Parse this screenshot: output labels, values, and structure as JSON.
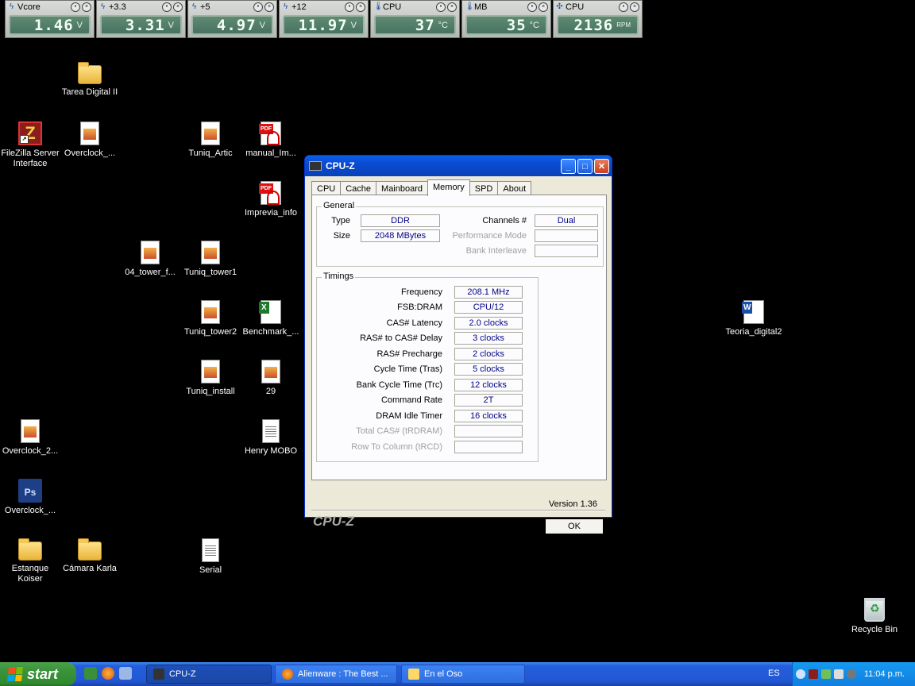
{
  "gadgets": [
    {
      "name": "Vcore",
      "value": "1.46",
      "unit": "V",
      "icon": "lightning-icon"
    },
    {
      "name": "+3.3",
      "value": "3.31",
      "unit": "V",
      "icon": "lightning-icon"
    },
    {
      "name": "+5",
      "value": "4.97",
      "unit": "V",
      "icon": "lightning-icon"
    },
    {
      "name": "+12",
      "value": "11.97",
      "unit": "V",
      "icon": "lightning-icon"
    },
    {
      "name": "CPU",
      "value": "37",
      "unit": "°C",
      "icon": "thermometer-icon"
    },
    {
      "name": "MB",
      "value": "35",
      "unit": "°C",
      "icon": "thermometer-icon"
    },
    {
      "name": "CPU",
      "value": "2136",
      "unit": "RPM",
      "icon": "fan-icon"
    }
  ],
  "desktop_icons": [
    {
      "label": "Tarea Digital II",
      "type": "folder"
    },
    {
      "label": "FileZilla Server Interface",
      "type": "filezilla"
    },
    {
      "label": "Overclock_...",
      "type": "image"
    },
    {
      "label": "Tuniq_Artic",
      "type": "image"
    },
    {
      "label": "manual_Im...",
      "type": "pdf"
    },
    {
      "label": "Imprevia_info",
      "type": "pdf"
    },
    {
      "label": "04_tower_f...",
      "type": "image"
    },
    {
      "label": "Tuniq_tower1",
      "type": "image"
    },
    {
      "label": "Tuniq_tower2",
      "type": "image"
    },
    {
      "label": "Benchmark_...",
      "type": "excel"
    },
    {
      "label": "Teoria_digital2",
      "type": "word"
    },
    {
      "label": "Tuniq_install",
      "type": "image"
    },
    {
      "label": "29",
      "type": "image"
    },
    {
      "label": "Overclock_2...",
      "type": "image"
    },
    {
      "label": "Henry MOBO",
      "type": "text"
    },
    {
      "label": "Overclock_...",
      "type": "photoshop"
    },
    {
      "label": "Estanque Koiser",
      "type": "folder"
    },
    {
      "label": "Cámara Karla",
      "type": "folder"
    },
    {
      "label": "Serial",
      "type": "text"
    },
    {
      "label": "Recycle Bin",
      "type": "recycle-bin"
    }
  ],
  "cpuz": {
    "title": "CPU-Z",
    "tabs": [
      "CPU",
      "Cache",
      "Mainboard",
      "Memory",
      "SPD",
      "About"
    ],
    "active_tab": "Memory",
    "general": {
      "title": "General",
      "type_label": "Type",
      "type_value": "DDR",
      "size_label": "Size",
      "size_value": "2048 MBytes",
      "channels_label": "Channels #",
      "channels_value": "Dual",
      "perf_mode_label": "Performance Mode",
      "perf_mode_value": "",
      "bank_interleave_label": "Bank Interleave",
      "bank_interleave_value": ""
    },
    "timings": {
      "title": "Timings",
      "rows": [
        {
          "label": "Frequency",
          "value": "208.1 MHz",
          "enabled": true
        },
        {
          "label": "FSB:DRAM",
          "value": "CPU/12",
          "enabled": true
        },
        {
          "label": "CAS# Latency",
          "value": "2.0 clocks",
          "enabled": true
        },
        {
          "label": "RAS# to CAS# Delay",
          "value": "3 clocks",
          "enabled": true
        },
        {
          "label": "RAS# Precharge",
          "value": "2 clocks",
          "enabled": true
        },
        {
          "label": "Cycle Time (Tras)",
          "value": "5 clocks",
          "enabled": true
        },
        {
          "label": "Bank Cycle Time (Trc)",
          "value": "12 clocks",
          "enabled": true
        },
        {
          "label": "Command Rate",
          "value": "2T",
          "enabled": true
        },
        {
          "label": "DRAM Idle Timer",
          "value": "16 clocks",
          "enabled": true
        },
        {
          "label": "Total CAS# (tRDRAM)",
          "value": "",
          "enabled": false
        },
        {
          "label": "Row To Column (tRCD)",
          "value": "",
          "enabled": false
        }
      ]
    },
    "version": "Version 1.36",
    "brand": "CPU-Z",
    "ok_label": "OK"
  },
  "taskbar": {
    "start_label": "start",
    "tasks": [
      {
        "label": "CPU-Z",
        "active": true
      },
      {
        "label": "Alienware : The Best ...",
        "active": false
      },
      {
        "label": "En el Oso",
        "active": false
      }
    ],
    "language": "ES",
    "clock": "11:04 p.m."
  },
  "colors": {
    "desktop": "#000000",
    "title_bar": "#0a4bd0",
    "value_text": "#000087",
    "taskbar": "#245edb",
    "start_button": "#3c943c"
  }
}
